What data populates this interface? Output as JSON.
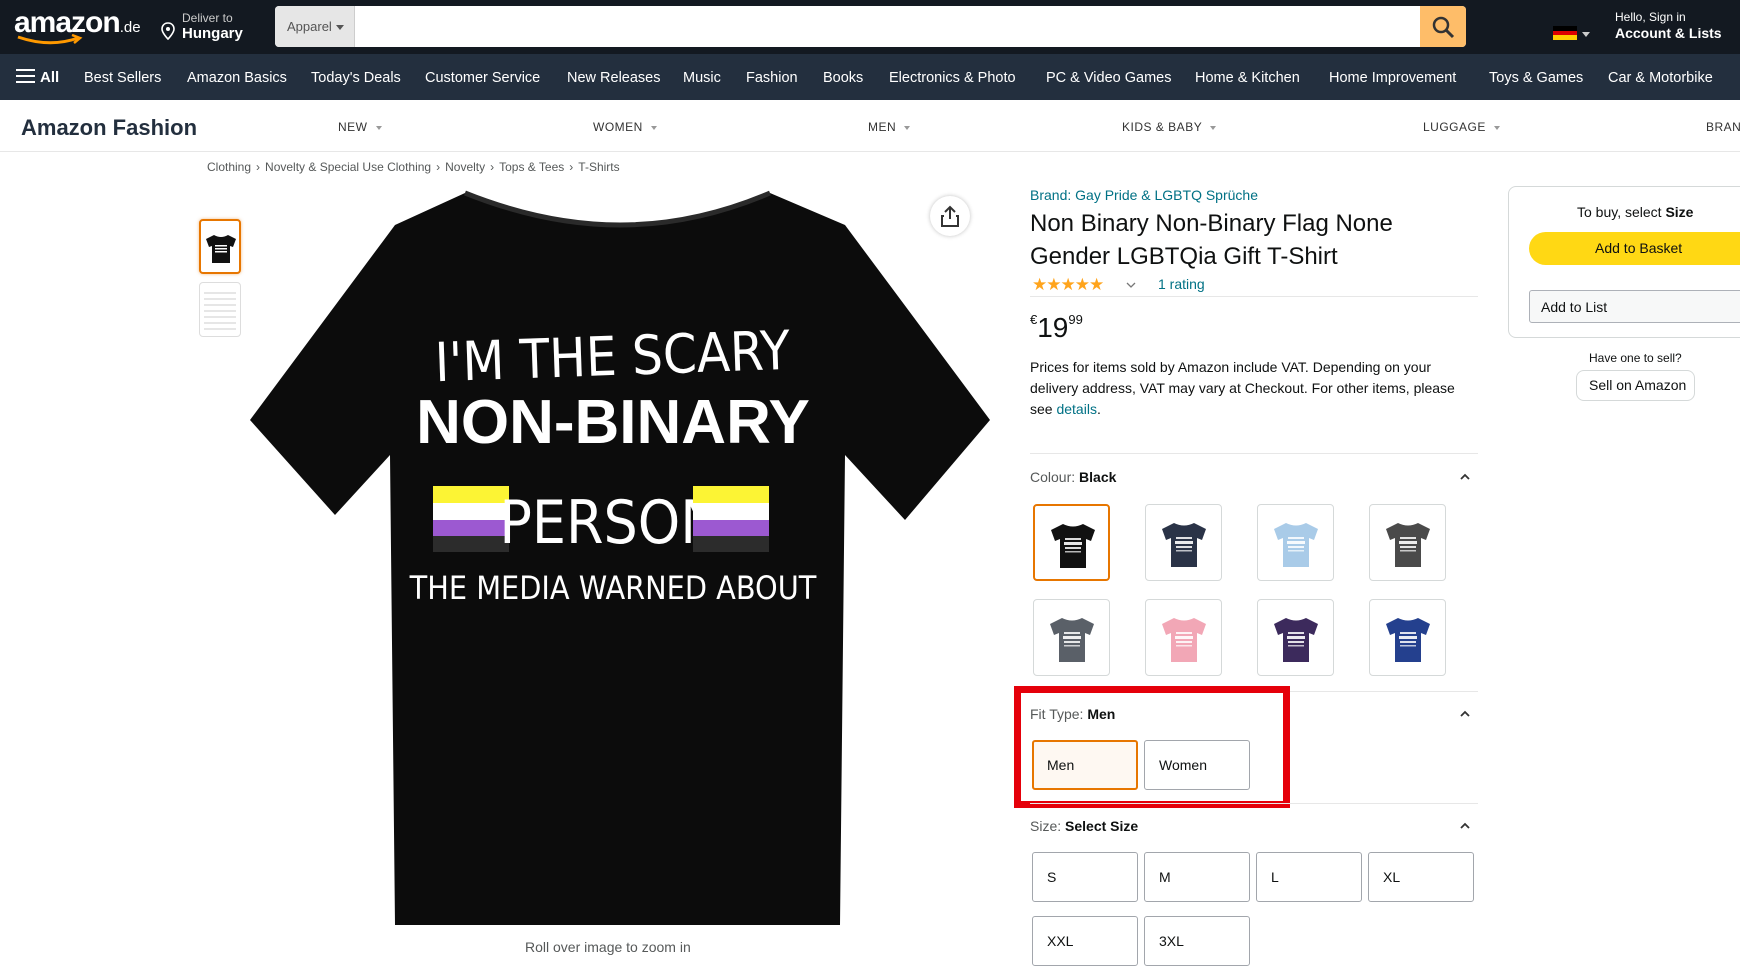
{
  "header": {
    "logo": "amazon",
    "logo_tld": ".de",
    "deliver_line1": "Deliver to",
    "deliver_line2": "Hungary",
    "search_category": "Apparel",
    "search_value": "",
    "account_line1": "Hello, Sign in",
    "account_line2": "Account & Lists",
    "icons": [
      "location-pin-icon",
      "search-icon",
      "germany-flag-icon",
      "chevron-down-icon",
      "hamburger-icon"
    ]
  },
  "subnav": {
    "all_label": "All",
    "items": [
      "Best Sellers",
      "Amazon Basics",
      "Today's Deals",
      "Customer Service",
      "New Releases",
      "Music",
      "Fashion",
      "Books",
      "Electronics & Photo",
      "PC & Video Games",
      "Home & Kitchen",
      "Home Improvement",
      "Toys & Games",
      "Car & Motorbike"
    ]
  },
  "fashion_bar": {
    "title": "Amazon Fashion",
    "menu": [
      "NEW",
      "WOMEN",
      "MEN",
      "KIDS & BABY",
      "LUGGAGE",
      "BRAN"
    ]
  },
  "breadcrumb": [
    "Clothing",
    "Novelty & Special Use Clothing",
    "Novelty",
    "Tops & Tees",
    "T-Shirts"
  ],
  "breadcrumb_sep": "›",
  "image": {
    "shirt_text": [
      "I'M THE SCARY",
      "NON-BINARY",
      "PERSON",
      "THE MEDIA WARNED ABOUT"
    ],
    "zoom_hint": "Roll over image to zoom in",
    "flag_colors": [
      "#fcf434",
      "#ffffff",
      "#9c59d1",
      "#2c2c2c"
    ]
  },
  "product": {
    "brand": "Brand: Gay Pride & LGBTQ Sprüche",
    "title": "Non Binary Non-Binary Flag None Gender LGBTQia Gift T-Shirt",
    "stars": "★★★★★",
    "rating_value": 5,
    "rating_count": "1 rating",
    "price_currency": "€",
    "price_whole": "19",
    "price_fraction": "99",
    "vat_text": "Prices for items sold by Amazon include VAT. Depending on your delivery address, VAT may vary at Checkout. For other items, please see ",
    "vat_link": "details",
    "vat_end": "."
  },
  "colour": {
    "label": "Colour: ",
    "selected": "Black",
    "swatches": [
      "#111111",
      "#2a3347",
      "#a9cbe8",
      "#4a4a4a",
      "#5a6068",
      "#f2a7b6",
      "#3c2a5c",
      "#24408e"
    ]
  },
  "fit": {
    "label": "Fit Type: ",
    "selected": "Men",
    "options": [
      "Men",
      "Women"
    ]
  },
  "size": {
    "label": "Size: ",
    "selected": "Select Size",
    "options": [
      "S",
      "M",
      "L",
      "XL",
      "XXL",
      "3XL"
    ]
  },
  "buybox": {
    "to_buy": "To buy, select ",
    "to_buy_bold": "Size",
    "add_to_basket": "Add to Basket",
    "add_to_list": "Add to List",
    "sell_question": "Have one to sell?",
    "sell_button": "Sell on Amazon"
  },
  "colors": {
    "nav_dark": "#131921",
    "nav_secondary": "#232f3e",
    "link": "#007185",
    "accent_orange": "#e77600",
    "basket_yellow": "#ffd814",
    "highlight_red": "#e5000a"
  }
}
